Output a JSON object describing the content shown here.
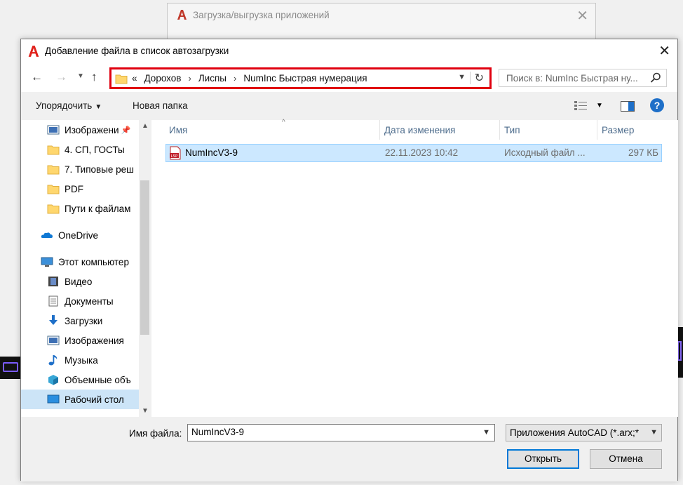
{
  "background_window": {
    "title": "Загрузка/выгрузка приложений",
    "close": "✕"
  },
  "dialog": {
    "title": "Добавление файла в список автозагрузки",
    "close": "✕",
    "nav": {
      "back": "←",
      "forward": "→",
      "recent": "⌄",
      "up": "↑",
      "breadcrumb_prefix": "«",
      "breadcrumbs": [
        "Дорохов",
        "Лиспы",
        "NumInc Быстрая нумерация"
      ],
      "separator": "›",
      "refresh": "↻",
      "dropdown": "⌄"
    },
    "search": {
      "placeholder": "Поиск в: NumInc Быстрая ну..."
    },
    "toolbar": {
      "organize": "Упорядочить",
      "new_folder": "Новая папка",
      "help": "?"
    },
    "navpane": {
      "items": [
        {
          "label": "Изображени",
          "icon": "pictures-icon",
          "pinned": true
        },
        {
          "label": "4. СП, ГОСТы",
          "icon": "folder-icon"
        },
        {
          "label": "7. Типовые реш",
          "icon": "folder-icon"
        },
        {
          "label": "PDF",
          "icon": "folder-icon"
        },
        {
          "label": "Пути к файлам",
          "icon": "folder-icon"
        },
        {
          "label": "OneDrive",
          "icon": "onedrive-icon"
        },
        {
          "label": "Этот компьютер",
          "icon": "computer-icon"
        },
        {
          "label": "Видео",
          "icon": "video-icon"
        },
        {
          "label": "Документы",
          "icon": "documents-icon"
        },
        {
          "label": "Загрузки",
          "icon": "downloads-icon"
        },
        {
          "label": "Изображения",
          "icon": "pictures-icon"
        },
        {
          "label": "Музыка",
          "icon": "music-icon"
        },
        {
          "label": "Объемные объ",
          "icon": "3d-objects-icon"
        },
        {
          "label": "Рабочий стол",
          "icon": "desktop-icon",
          "selected": true
        }
      ]
    },
    "filelist": {
      "columns": [
        "Имя",
        "Дата изменения",
        "Тип",
        "Размер"
      ],
      "rows": [
        {
          "name": "NumIncV3-9",
          "date": "22.11.2023 10:42",
          "type": "Исходный файл ...",
          "size": "297 КБ"
        }
      ]
    },
    "bottom": {
      "filename_label": "Имя файла:",
      "filename_value": "NumIncV3-9",
      "filetype": "Приложения AutoCAD (*.arx;*",
      "open": "Открыть",
      "cancel": "Отмена"
    },
    "colors": {
      "accent": "#0078d7",
      "highlight": "#e0000f",
      "selection": "#cce8ff"
    }
  }
}
